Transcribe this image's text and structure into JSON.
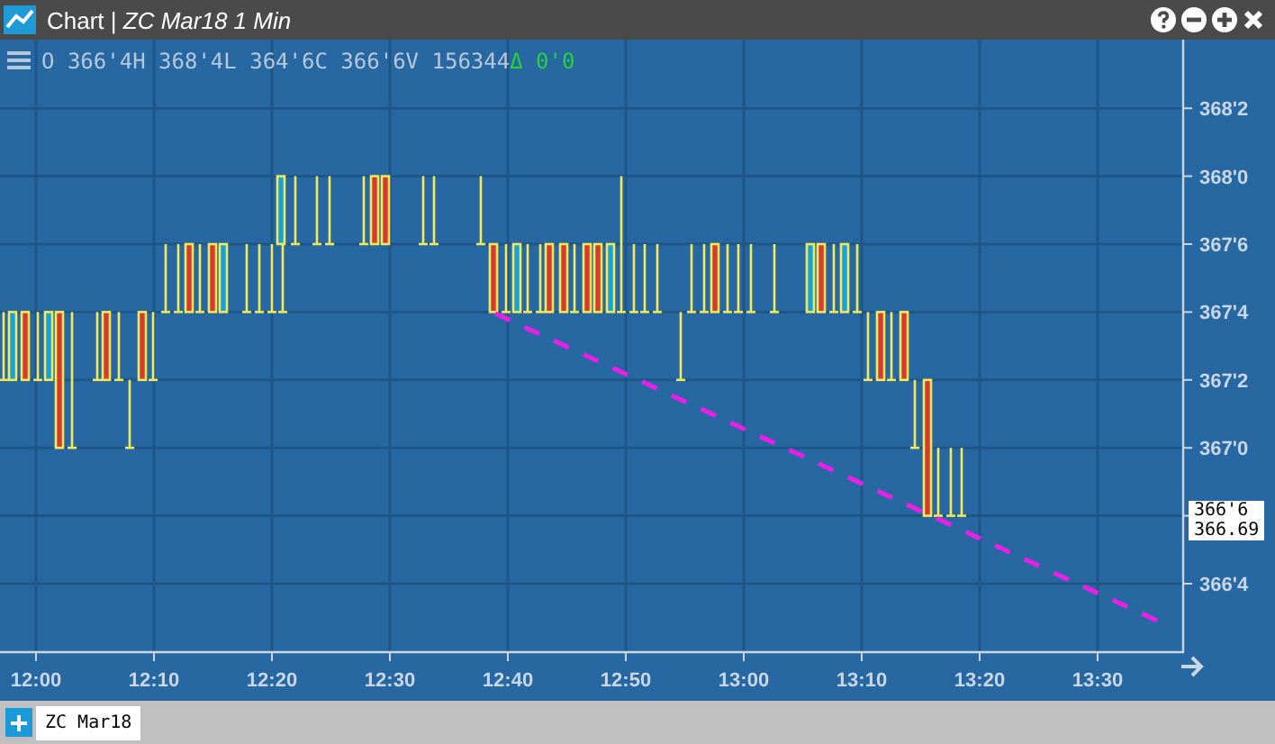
{
  "window": {
    "title": "Chart | *ZC Mar18 1 Min*"
  },
  "quote_bar": {
    "ohlc": "O 366'4H 368'4L 364'6C 366'6V 156344",
    "change": "Δ 0'0"
  },
  "chart": {
    "y_labels_above_tag": [
      "368'2",
      "368'0",
      "367'6",
      "367'4",
      "367'2",
      "367'0"
    ],
    "y_labels_below_tag": [
      "366'4"
    ],
    "x_labels": [
      "12:00",
      "12:10",
      "12:20",
      "12:30",
      "12:40",
      "12:50",
      "13:00",
      "13:10",
      "13:20",
      "13:30"
    ],
    "price_tag": "366'6",
    "price_value": "366.69"
  },
  "tabs": [
    {
      "label": "ZC Mar18",
      "selected": true
    }
  ]
}
